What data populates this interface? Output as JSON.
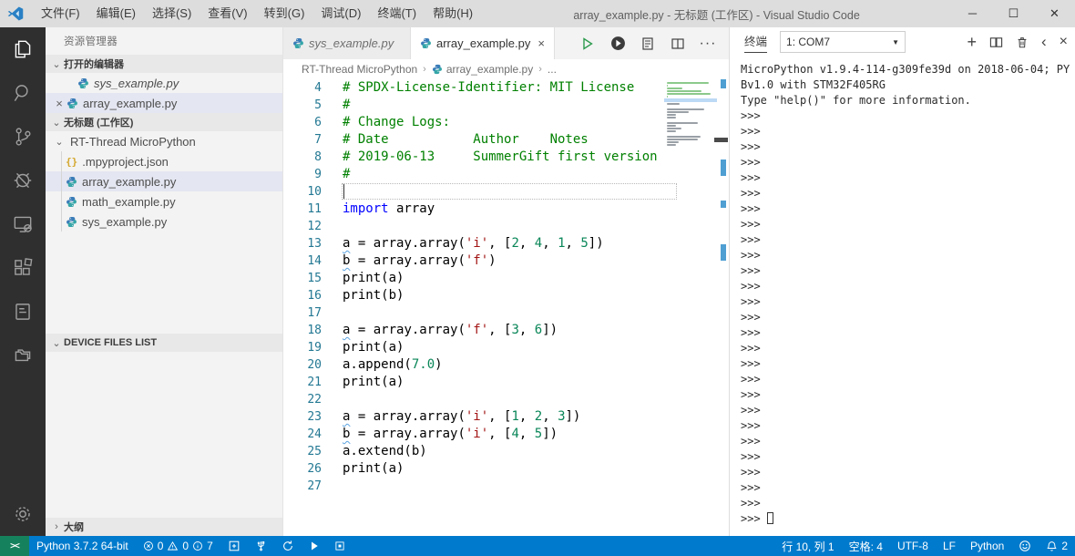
{
  "colors": {
    "accent": "#007acc",
    "remote": "#16825d",
    "titlebar": "#dddddd",
    "activity": "#2f2f2f",
    "sidebar": "#f3f3f3",
    "selection": "#e4e6f1",
    "comment": "#008000",
    "keyword": "#0000ff",
    "string": "#a31515",
    "number": "#098658",
    "linenum": "#237893"
  },
  "title_bar": {
    "app_title": "array_example.py - 无标题 (工作区) - Visual Studio Code",
    "menus": [
      "文件(F)",
      "编辑(E)",
      "选择(S)",
      "查看(V)",
      "转到(G)",
      "调试(D)",
      "终端(T)",
      "帮助(H)"
    ],
    "window_controls": {
      "minimize": "─",
      "maximize": "☐",
      "close": "✕"
    }
  },
  "activity_bar": {
    "items": [
      "explorer",
      "search",
      "source-control",
      "debug",
      "remote-device",
      "extensions",
      "notebook",
      "folders"
    ],
    "bottom": [
      "settings"
    ]
  },
  "sidebar": {
    "title": "资源管理器",
    "open_editors": {
      "header": "打开的编辑器",
      "items": [
        {
          "label": "sys_example.py",
          "preview": true,
          "active": false
        },
        {
          "label": "array_example.py",
          "preview": false,
          "active": true
        }
      ]
    },
    "workspace": {
      "header": "无标题 (工作区)",
      "folder": "RT-Thread MicroPython",
      "files": [
        ".mpyproject.json",
        "array_example.py",
        "math_example.py",
        "sys_example.py"
      ],
      "selected_file": "array_example.py"
    },
    "device_files": {
      "header": "DEVICE FILES LIST"
    },
    "outline": {
      "header": "大纲"
    }
  },
  "editor": {
    "tabs": [
      {
        "label": "sys_example.py",
        "preview": true,
        "active": false
      },
      {
        "label": "array_example.py",
        "preview": false,
        "active": true
      }
    ],
    "toolbar_icons": [
      "run-file",
      "run-code",
      "open-preview",
      "split-editor",
      "more-actions"
    ],
    "breadcrumb": [
      "RT-Thread MicroPython",
      "array_example.py",
      "..."
    ],
    "code_lines": [
      {
        "n": 4,
        "t": [
          [
            "c",
            "# SPDX-License-Identifier: MIT License"
          ]
        ]
      },
      {
        "n": 5,
        "t": [
          [
            "c",
            "#"
          ]
        ]
      },
      {
        "n": 6,
        "t": [
          [
            "c",
            "# Change Logs:"
          ]
        ]
      },
      {
        "n": 7,
        "t": [
          [
            "c",
            "# Date           Author    Notes"
          ]
        ]
      },
      {
        "n": 8,
        "t": [
          [
            "c",
            "# 2019-06-13     SummerGift first version"
          ]
        ]
      },
      {
        "n": 9,
        "t": [
          [
            "c",
            "#"
          ]
        ]
      },
      {
        "n": 10,
        "t": [],
        "current": true
      },
      {
        "n": 11,
        "t": [
          [
            "k",
            "import"
          ],
          [
            "d",
            " array"
          ]
        ]
      },
      {
        "n": 12,
        "t": []
      },
      {
        "n": 13,
        "t": [
          [
            "v",
            "a"
          ],
          [
            "d",
            " = array.array("
          ],
          [
            "s",
            "'i'"
          ],
          [
            "d",
            ", ["
          ],
          [
            "n",
            "2"
          ],
          [
            "d",
            ", "
          ],
          [
            "n",
            "4"
          ],
          [
            "d",
            ", "
          ],
          [
            "n",
            "1"
          ],
          [
            "d",
            ", "
          ],
          [
            "n",
            "5"
          ],
          [
            "d",
            "])"
          ]
        ]
      },
      {
        "n": 14,
        "t": [
          [
            "v",
            "b"
          ],
          [
            "d",
            " = array.array("
          ],
          [
            "s",
            "'f'"
          ],
          [
            "d",
            ")"
          ]
        ]
      },
      {
        "n": 15,
        "t": [
          [
            "d",
            "print(a)"
          ]
        ]
      },
      {
        "n": 16,
        "t": [
          [
            "d",
            "print(b)"
          ]
        ]
      },
      {
        "n": 17,
        "t": []
      },
      {
        "n": 18,
        "t": [
          [
            "v",
            "a"
          ],
          [
            "d",
            " = array.array("
          ],
          [
            "s",
            "'f'"
          ],
          [
            "d",
            ", ["
          ],
          [
            "n",
            "3"
          ],
          [
            "d",
            ", "
          ],
          [
            "n",
            "6"
          ],
          [
            "d",
            "])"
          ]
        ]
      },
      {
        "n": 19,
        "t": [
          [
            "d",
            "print(a)"
          ]
        ]
      },
      {
        "n": 20,
        "t": [
          [
            "d",
            "a.append("
          ],
          [
            "n",
            "7.0"
          ],
          [
            "d",
            ")"
          ]
        ]
      },
      {
        "n": 21,
        "t": [
          [
            "d",
            "print(a)"
          ]
        ]
      },
      {
        "n": 22,
        "t": []
      },
      {
        "n": 23,
        "t": [
          [
            "v",
            "a"
          ],
          [
            "d",
            " = array.array("
          ],
          [
            "s",
            "'i'"
          ],
          [
            "d",
            ", ["
          ],
          [
            "n",
            "1"
          ],
          [
            "d",
            ", "
          ],
          [
            "n",
            "2"
          ],
          [
            "d",
            ", "
          ],
          [
            "n",
            "3"
          ],
          [
            "d",
            "])"
          ]
        ]
      },
      {
        "n": 24,
        "t": [
          [
            "v",
            "b"
          ],
          [
            "d",
            " = array.array("
          ],
          [
            "s",
            "'i'"
          ],
          [
            "d",
            ", ["
          ],
          [
            "n",
            "4"
          ],
          [
            "d",
            ", "
          ],
          [
            "n",
            "5"
          ],
          [
            "d",
            "])"
          ]
        ]
      },
      {
        "n": 25,
        "t": [
          [
            "d",
            "a.extend(b)"
          ]
        ]
      },
      {
        "n": 26,
        "t": [
          [
            "d",
            "print(a)"
          ]
        ]
      },
      {
        "n": 27,
        "t": []
      }
    ]
  },
  "terminal": {
    "panel_title": "终端",
    "dropdown_value": "1: COM7",
    "header_icons": [
      "new-terminal",
      "split-terminal",
      "kill-terminal",
      "collapse-panel",
      "close-panel"
    ],
    "output": [
      "MicroPython v1.9.4-114-g309fe39d on 2018-06-04; PY",
      "Bv1.0 with STM32F405RG",
      "Type \"help()\" for more information."
    ],
    "prompt": ">>>",
    "prompt_repeat": 26,
    "cursor": true
  },
  "status_bar": {
    "left": {
      "remote_icon": "><",
      "python_version": "Python 3.7.2 64-bit",
      "errors": "0",
      "warnings": "0",
      "infos": "7",
      "action_icons": [
        "add-project",
        "usb-device",
        "sync-download",
        "run",
        "stop"
      ]
    },
    "right": {
      "cursor_position": "行 10, 列 1",
      "indent": "空格: 4",
      "encoding": "UTF-8",
      "eol": "LF",
      "language": "Python",
      "notifications": "2"
    }
  }
}
